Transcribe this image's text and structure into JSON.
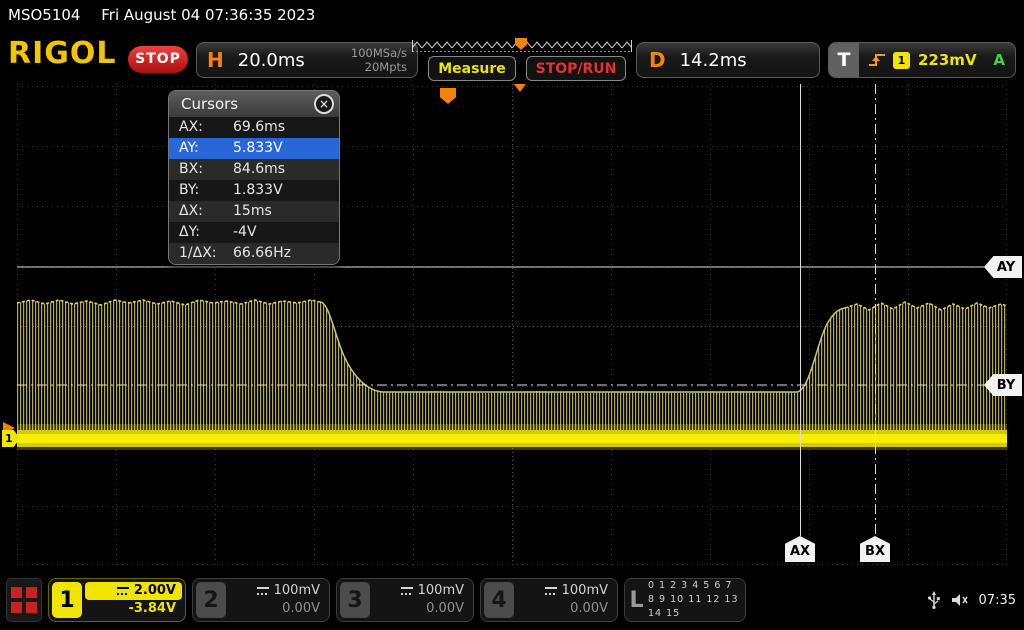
{
  "statusbar": {
    "model": "MSO5104",
    "datetime": "Fri August 04 07:36:35 2023"
  },
  "header": {
    "brand": "RIGOL",
    "stop_badge": "STOP",
    "horizontal": {
      "label": "H",
      "timebase": "20.0ms",
      "sample_rate": "100MSa/s",
      "mem_depth": "20Mpts"
    },
    "measure_label": "Measure",
    "stoprun_label": "STOP/RUN",
    "delay": {
      "label": "D",
      "value": "14.2ms"
    },
    "trigger": {
      "label": "T",
      "source_badge": "1",
      "level": "223mV",
      "mode": "A"
    }
  },
  "cursors_panel": {
    "title": "Cursors",
    "close_icon": "×",
    "rows": [
      {
        "label": "AX:",
        "value": "69.6ms",
        "selected": false
      },
      {
        "label": "AY:",
        "value": "5.833V",
        "selected": true
      },
      {
        "label": "BX:",
        "value": "84.6ms",
        "selected": false
      },
      {
        "label": "BY:",
        "value": "1.833V",
        "selected": false
      },
      {
        "label": "ΔX:",
        "value": "15ms",
        "selected": false
      },
      {
        "label": "ΔY:",
        "value": "-4V",
        "selected": false
      },
      {
        "label": "1/ΔX:",
        "value": "66.66Hz",
        "selected": false
      }
    ]
  },
  "cursor_tags": {
    "ax": "AX",
    "ay": "AY",
    "bx": "BX",
    "by": "BY"
  },
  "markers": {
    "ch1": "1"
  },
  "channels": [
    {
      "id": "1",
      "scale": "2.00V",
      "offset": "-3.84V",
      "active": true,
      "color": "#f0e500"
    },
    {
      "id": "2",
      "scale": "100mV",
      "offset": "0.00V",
      "active": false
    },
    {
      "id": "3",
      "scale": "100mV",
      "offset": "0.00V",
      "active": false
    },
    {
      "id": "4",
      "scale": "100mV",
      "offset": "0.00V",
      "active": false
    }
  ],
  "logic": {
    "label": "L",
    "row1": "0 1 2 3 4 5 6 7",
    "row2": "8 9 10 11 12 13 14 15"
  },
  "statusicons": {
    "clock": "07:35"
  },
  "waveform": {
    "channel": "1",
    "color": "#f0e500"
  }
}
